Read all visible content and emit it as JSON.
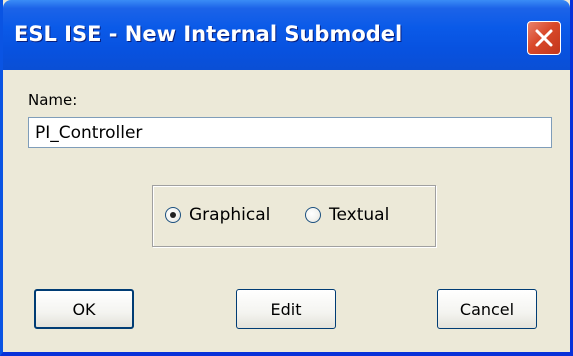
{
  "window": {
    "title": "ESL ISE - New Internal Submodel"
  },
  "form": {
    "name_label": "Name:",
    "name_value": "PI_Controller",
    "mode_options": [
      "Graphical",
      "Textual"
    ],
    "mode_selected": "Graphical"
  },
  "buttons": {
    "ok": "OK",
    "edit": "Edit",
    "cancel": "Cancel"
  },
  "colors": {
    "titlebar": "#0a5ae8",
    "dialog_bg": "#ece9d8",
    "close": "#d9492a"
  },
  "icons": {
    "close": "close-x-icon"
  }
}
